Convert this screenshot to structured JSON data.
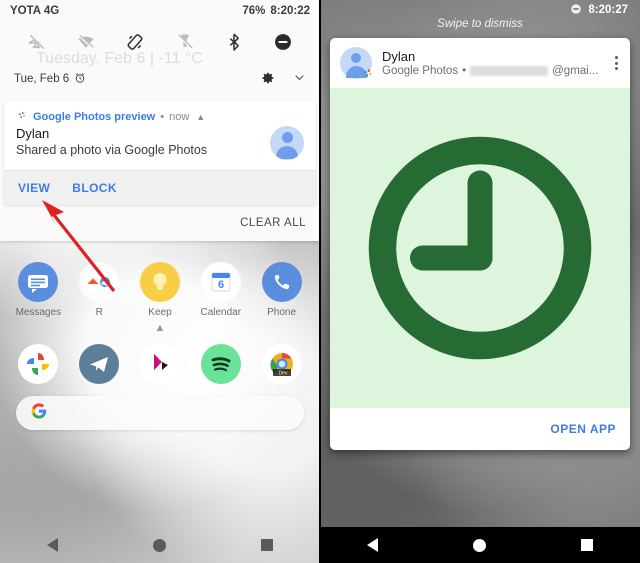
{
  "left": {
    "statusbar": {
      "carrier": "YOTA 4G",
      "battery": "76%",
      "clock": "8:20:22"
    },
    "quick_settings": {
      "icons": [
        {
          "name": "airplane-mode-icon",
          "label": "Airplane mode off"
        },
        {
          "name": "wifi-off-icon",
          "label": "Wi-Fi off"
        },
        {
          "name": "auto-rotate-icon",
          "label": "Auto-rotate"
        },
        {
          "name": "flashlight-off-icon",
          "label": "Flashlight off"
        },
        {
          "name": "bluetooth-icon",
          "label": "Bluetooth"
        },
        {
          "name": "do-not-disturb-icon",
          "label": "Do not disturb"
        }
      ],
      "date": "Tue, Feb 6",
      "ghost_text": "Tuesday, Feb 6  |     -11 °C",
      "alarm_icon": "alarm-icon",
      "settings_icon": "gear-icon",
      "expand_icon": "chevron-down-icon"
    },
    "notification": {
      "app_name": "Google Photos preview",
      "separator": "•",
      "time": "now",
      "collapse_icon": "chevron-up-icon",
      "title": "Dylan",
      "subtitle": "Shared a photo via Google Photos",
      "avatar": "avatar",
      "actions": [
        {
          "name": "view-button",
          "label": "VIEW"
        },
        {
          "name": "block-button",
          "label": "BLOCK"
        }
      ]
    },
    "clear_all_label": "CLEAR ALL",
    "home": {
      "apps": [
        {
          "name": "app-messages",
          "label": "Messages",
          "icon": "messages-icon"
        },
        {
          "name": "app-folder-r",
          "label": "R",
          "icon": "folder-icon"
        },
        {
          "name": "app-keep",
          "label": "Keep",
          "icon": "keep-icon"
        },
        {
          "name": "app-calendar",
          "label": "Calendar",
          "icon": "calendar-icon",
          "day": "6"
        },
        {
          "name": "app-phone",
          "label": "Phone",
          "icon": "phone-icon"
        }
      ],
      "page_indicator_icon": "chevron-up-icon",
      "dock": [
        {
          "name": "dock-google-photos",
          "icon": "google-photos-icon"
        },
        {
          "name": "dock-telegram",
          "icon": "telegram-icon"
        },
        {
          "name": "dock-play-music",
          "icon": "play-music-icon"
        },
        {
          "name": "dock-spotify",
          "icon": "spotify-icon"
        },
        {
          "name": "dock-chrome-dev",
          "icon": "chrome-dev-icon",
          "label": "Dev"
        }
      ],
      "search_placeholder": "",
      "search_icon": "google-g-icon"
    },
    "navbar": [
      {
        "name": "nav-back-button",
        "icon": "back-triangle-icon"
      },
      {
        "name": "nav-home-button",
        "icon": "home-circle-icon"
      },
      {
        "name": "nav-recents-button",
        "icon": "recents-square-icon"
      }
    ],
    "annotation": {
      "name": "red-arrow-annotation",
      "color": "#e02020",
      "points_to": "VIEW"
    }
  },
  "right": {
    "statusbar": {
      "clock": "8:20:27",
      "dnd_icon": "do-not-disturb-icon"
    },
    "swipe_hint": "Swipe to dismiss",
    "heads_up": {
      "title": "Dylan",
      "app_name": "Google Photos",
      "separator": "•",
      "email_suffix": "@gmai...",
      "email_redacted": true,
      "menu_icon": "kebab-menu-icon",
      "avatar": "avatar",
      "app_badge": "google-photos-icon",
      "image": {
        "name": "clock-image",
        "bg_color": "#ddf5dd",
        "fg_color": "#266b33"
      },
      "action_label": "OPEN APP"
    },
    "navbar": [
      {
        "name": "nav-back-button",
        "icon": "back-triangle-icon"
      },
      {
        "name": "nav-home-button",
        "icon": "home-circle-icon"
      },
      {
        "name": "nav-recents-button",
        "icon": "recents-square-icon"
      }
    ]
  }
}
